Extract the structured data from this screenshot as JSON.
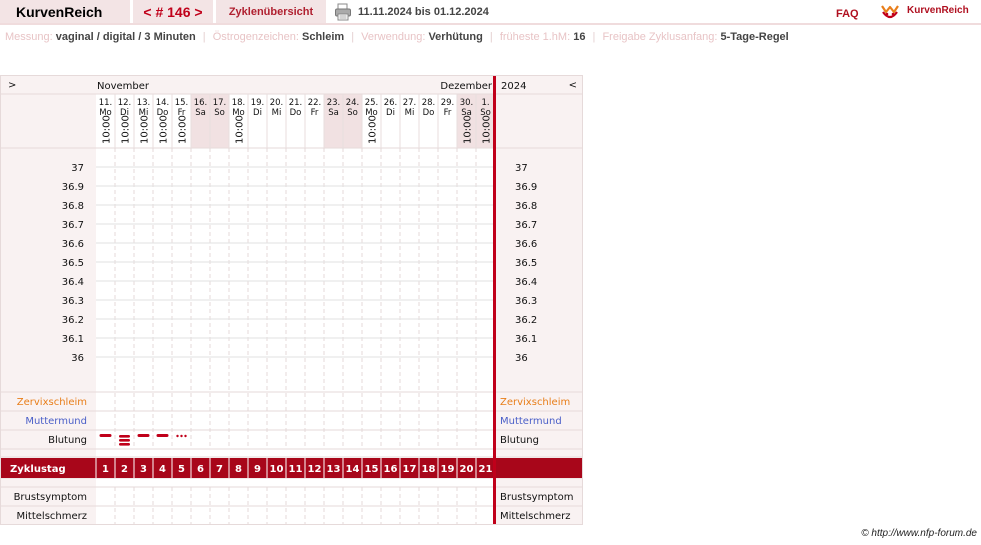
{
  "header": {
    "app_title": "KurvenReich",
    "cycle_nav": "< # 146 >",
    "overview_tab": "Zyklenübersicht",
    "date_range": "11.11.2024 bis 01.12.2024",
    "faq": "FAQ",
    "brand": "KurvenReich",
    "icons": [
      "printer-icon",
      "kurvenreich-logo-icon"
    ]
  },
  "info": {
    "messung_label": "Messung:",
    "messung_value": "vaginal / digital / 3 Minuten",
    "oestrogen_label": "Östrogenzeichen:",
    "oestrogen_value": "Schleim",
    "verwendung_label": "Verwendung:",
    "verwendung_value": "Verhütung",
    "fruehest_label": "früheste 1.hM:",
    "fruehest_value": "16",
    "freigabe_label": "Freigabe Zyklusanfang:",
    "freigabe_value": "5-Tage-Regel"
  },
  "chart": {
    "nav_prev": ">",
    "nav_next": "<",
    "month_start": "November",
    "month_end": "Dezember",
    "year": "2024",
    "temp_labels": [
      "37",
      "36.9",
      "36.8",
      "36.7",
      "36.6",
      "36.5",
      "36.4",
      "36.3",
      "36.2",
      "36.1",
      "36"
    ],
    "days": [
      {
        "date": "11.",
        "wd": "Mo",
        "time": "10:00",
        "weekend": false
      },
      {
        "date": "12.",
        "wd": "Di",
        "time": "10:00",
        "weekend": false
      },
      {
        "date": "13.",
        "wd": "Mi",
        "time": "10:00",
        "weekend": false
      },
      {
        "date": "14.",
        "wd": "Do",
        "time": "10:00",
        "weekend": false
      },
      {
        "date": "15.",
        "wd": "Fr",
        "time": "10:00",
        "weekend": false
      },
      {
        "date": "16.",
        "wd": "Sa",
        "time": "",
        "weekend": true
      },
      {
        "date": "17.",
        "wd": "So",
        "time": "",
        "weekend": true
      },
      {
        "date": "18.",
        "wd": "Mo",
        "time": "10:00",
        "weekend": false
      },
      {
        "date": "19.",
        "wd": "Di",
        "time": "",
        "weekend": false
      },
      {
        "date": "20.",
        "wd": "Mi",
        "time": "",
        "weekend": false
      },
      {
        "date": "21.",
        "wd": "Do",
        "time": "",
        "weekend": false
      },
      {
        "date": "22.",
        "wd": "Fr",
        "time": "",
        "weekend": false
      },
      {
        "date": "23.",
        "wd": "Sa",
        "time": "",
        "weekend": true
      },
      {
        "date": "24.",
        "wd": "So",
        "time": "",
        "weekend": true
      },
      {
        "date": "25.",
        "wd": "Mo",
        "time": "10:00",
        "weekend": false
      },
      {
        "date": "26.",
        "wd": "Di",
        "time": "",
        "weekend": false
      },
      {
        "date": "27.",
        "wd": "Mi",
        "time": "",
        "weekend": false
      },
      {
        "date": "28.",
        "wd": "Do",
        "time": "",
        "weekend": false
      },
      {
        "date": "29.",
        "wd": "Fr",
        "time": "",
        "weekend": false
      },
      {
        "date": "30.",
        "wd": "Sa",
        "time": "10:00",
        "weekend": true
      },
      {
        "date": "1.",
        "wd": "So",
        "time": "10:00",
        "weekend": true
      }
    ],
    "rows": {
      "zervix": "Zervixschleim",
      "muttermund": "Muttermund",
      "blutung": "Blutung",
      "zyklustag": "Zyklustag",
      "brust": "Brustsymptom",
      "mittel": "Mittelschmerz"
    },
    "cycle_days": [
      "1",
      "2",
      "3",
      "4",
      "5",
      "6",
      "7",
      "8",
      "9",
      "10",
      "11",
      "12",
      "13",
      "14",
      "15",
      "16",
      "17",
      "18",
      "19",
      "20",
      "21"
    ],
    "bleeding": [
      {
        "day": 1,
        "level": "medium"
      },
      {
        "day": 2,
        "level": "heavy"
      },
      {
        "day": 3,
        "level": "medium"
      },
      {
        "day": 4,
        "level": "medium"
      },
      {
        "day": 5,
        "level": "spotting"
      }
    ],
    "colors": {
      "accent_red": "#c0001a",
      "zyklustag_bg": "#a8061a",
      "zervix_label": "#e87e1a",
      "muttermund_label": "#4a5fc8",
      "weekend_bg": "#f1e1e2",
      "panel_bg": "#f9f2f2"
    }
  },
  "footer": {
    "copyright": "© http://www.nfp-forum.de"
  }
}
